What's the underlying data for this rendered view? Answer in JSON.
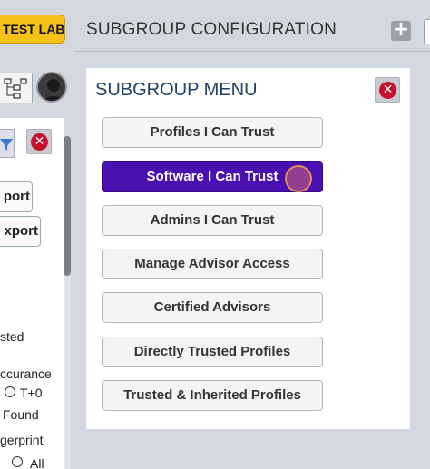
{
  "sidebar": {
    "test_lab_label": "TEST LAB",
    "buttons": [
      {
        "label": "port"
      },
      {
        "label": "xport"
      }
    ],
    "texts": {
      "sted": "sted",
      "accurance": "ccurance",
      "t0": "T+0",
      "found": "Found",
      "gerprint": "gerprint",
      "all": "All"
    }
  },
  "header": {
    "title": "SUBGROUP CONFIGURATION",
    "add_icon": "plus-icon"
  },
  "menu": {
    "title": "SUBGROUP MENU",
    "items": [
      {
        "label": "Profiles I Can Trust",
        "active": false
      },
      {
        "label": "Software I Can Trust",
        "active": true
      },
      {
        "label": "Admins I Can Trust",
        "active": false
      },
      {
        "label": "Manage Advisor Access",
        "active": false
      },
      {
        "label": "Certified Advisors",
        "active": false
      },
      {
        "label": "Directly Trusted Profiles",
        "active": false
      },
      {
        "label": "Trusted & Inherited Profiles",
        "active": false
      }
    ]
  },
  "colors": {
    "accent": "#4a0fb0",
    "test_lab": "#f6c21a",
    "close": "#c8102e"
  }
}
